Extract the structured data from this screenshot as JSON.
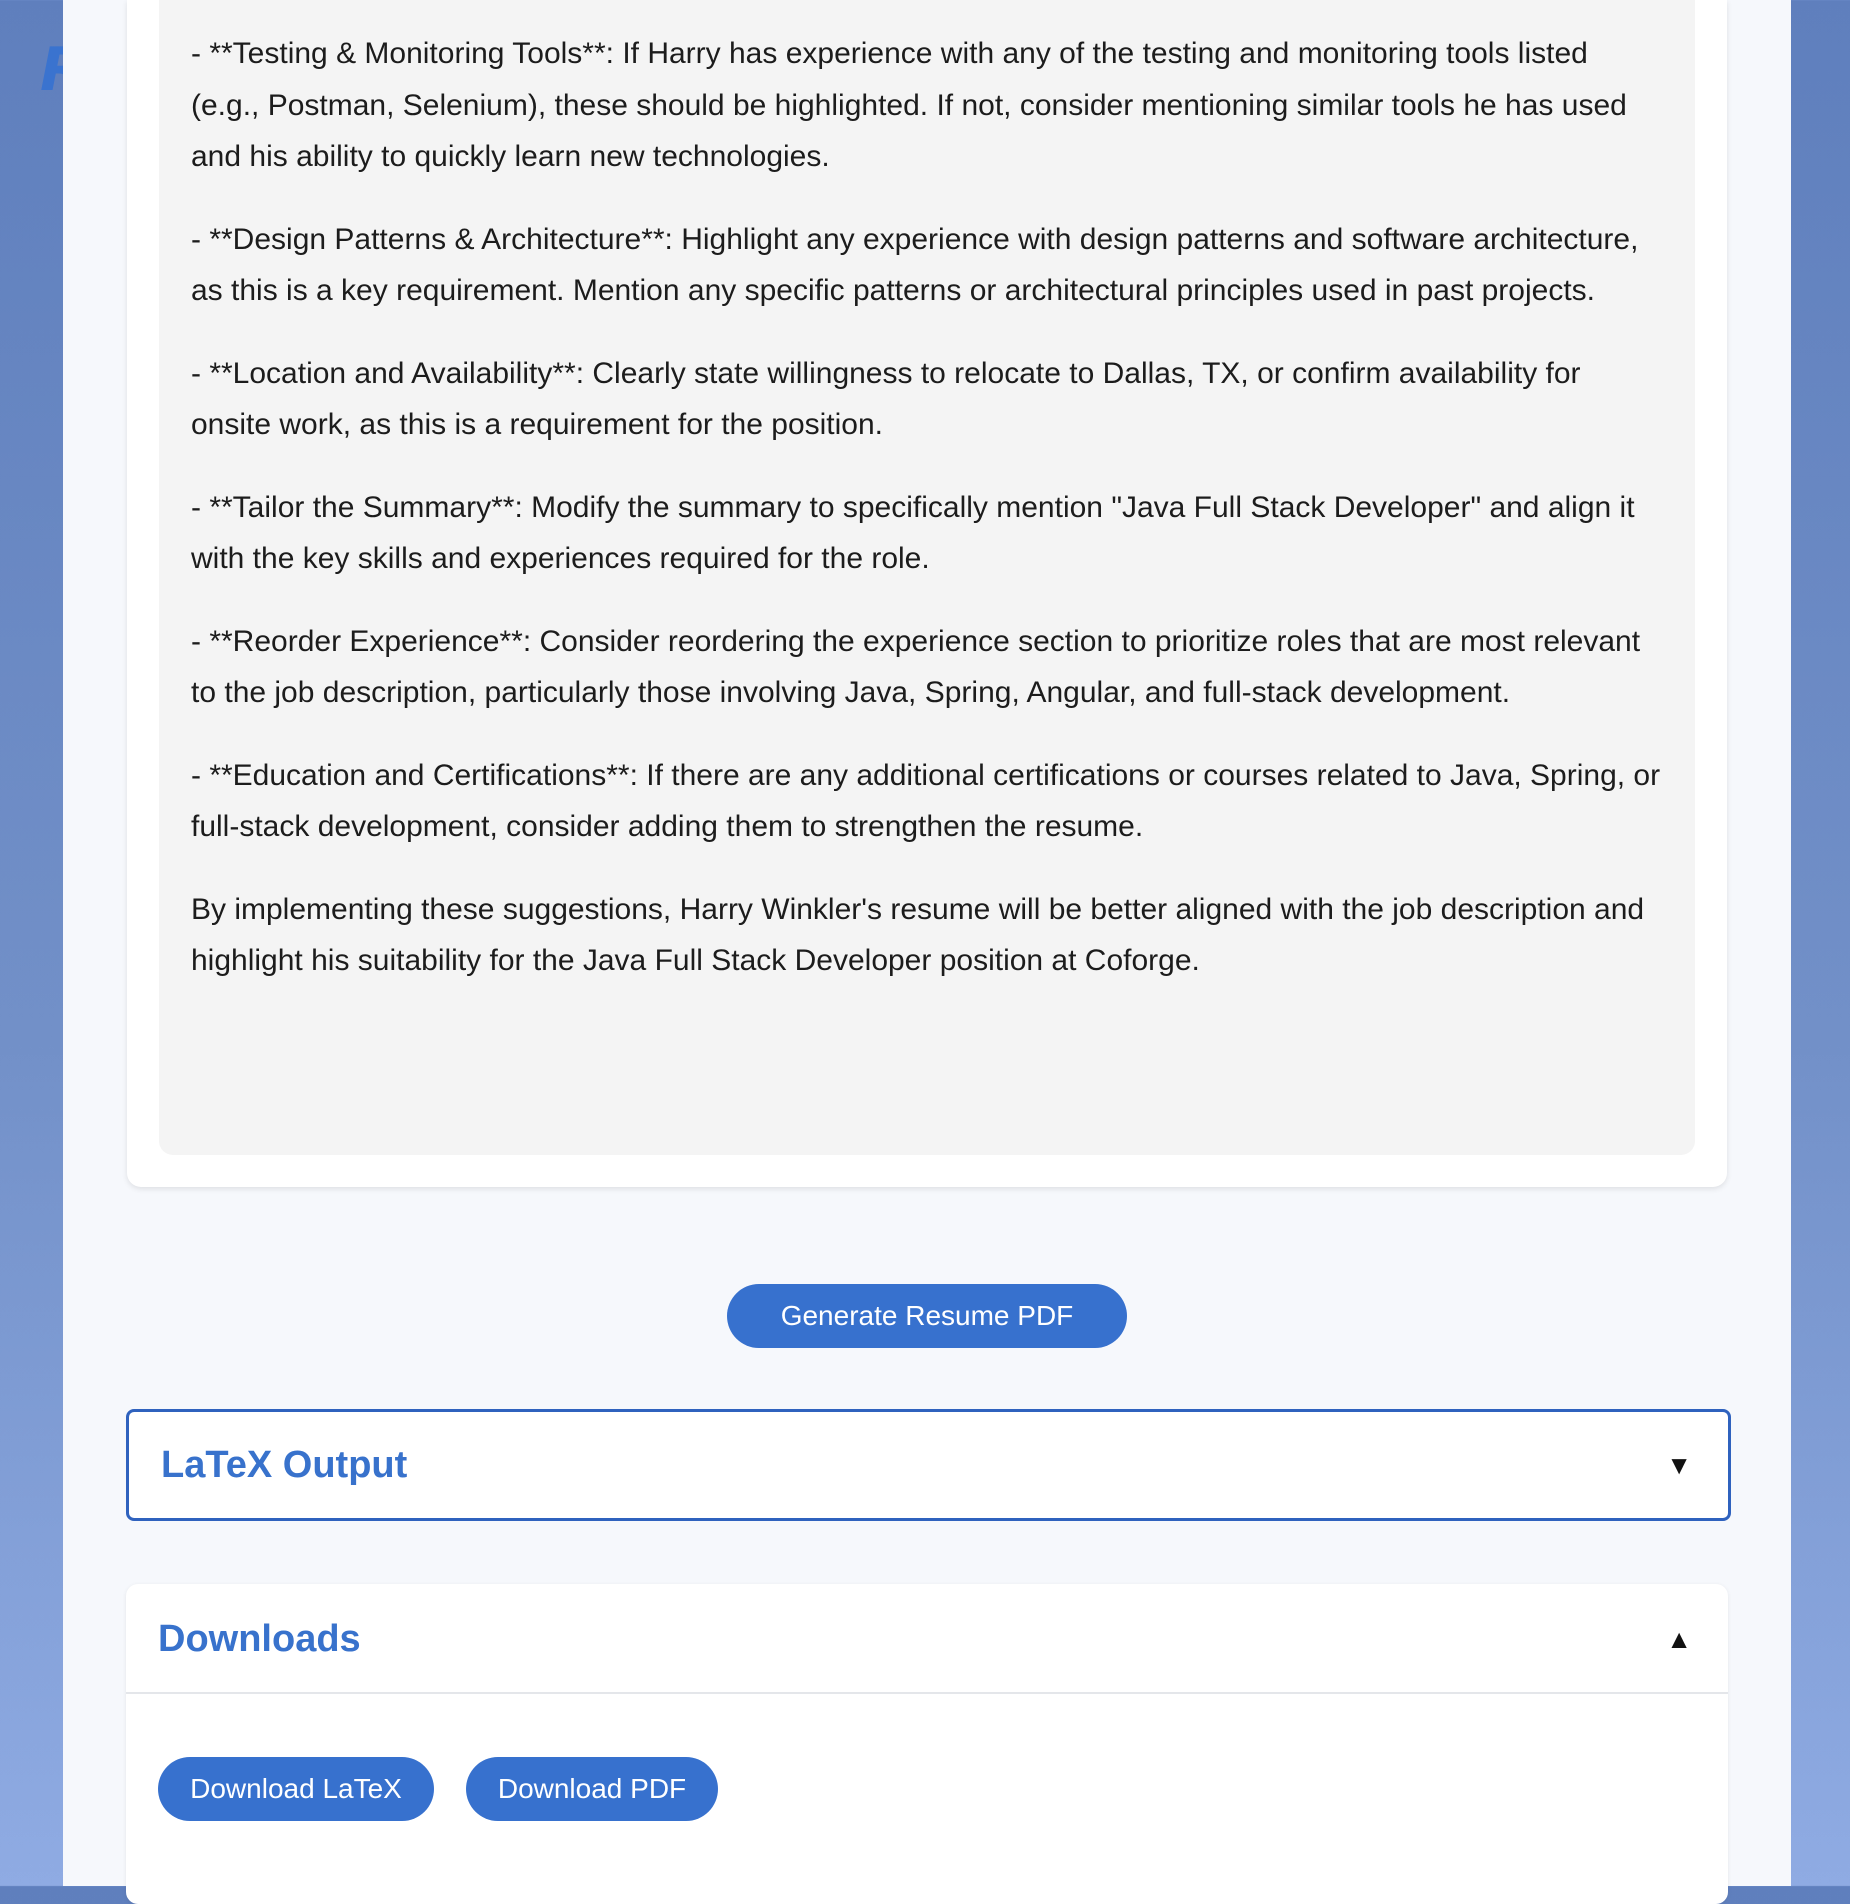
{
  "logo": {
    "letter": "R"
  },
  "suggestions": [
    "- **Testing & Monitoring Tools**: If Harry has experience with any of the testing and monitoring tools listed (e.g., Postman, Selenium), these should be highlighted. If not, consider mentioning similar tools he has used and his ability to quickly learn new technologies.",
    "- **Design Patterns & Architecture**: Highlight any experience with design patterns and software architecture, as this is a key requirement. Mention any specific patterns or architectural principles used in past projects.",
    "- **Location and Availability**: Clearly state willingness to relocate to Dallas, TX, or confirm availability for onsite work, as this is a requirement for the position.",
    "- **Tailor the Summary**: Modify the summary to specifically mention \"Java Full Stack Developer\" and align it with the key skills and experiences required for the role.",
    "- **Reorder Experience**: Consider reordering the experience section to prioritize roles that are most relevant to the job description, particularly those involving Java, Spring, Angular, and full-stack development.",
    "- **Education and Certifications**: If there are any additional certifications or courses related to Java, Spring, or full-stack development, consider adding them to strengthen the resume.",
    "By implementing these suggestions, Harry Winkler's resume will be better aligned with the job description and highlight his suitability for the Java Full Stack Developer position at Coforge."
  ],
  "generate_button": {
    "label": "Generate Resume PDF"
  },
  "latex_section": {
    "title": "LaTeX Output",
    "arrow": "▼"
  },
  "downloads_section": {
    "title": "Downloads",
    "arrow": "▲",
    "latex_button": "Download LaTeX",
    "pdf_button": "Download PDF"
  },
  "colors": {
    "accent": "#3771ce",
    "heading": "#3872cc",
    "border_active": "#2f62be",
    "panel_bg": "#f6f8fc",
    "suggestions_bg": "#f4f4f4"
  },
  "icons": {
    "latex_toggle": "chevron-down-icon",
    "downloads_toggle": "chevron-up-icon"
  }
}
